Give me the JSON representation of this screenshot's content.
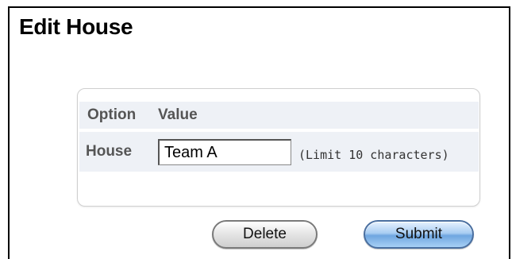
{
  "page": {
    "title": "Edit House"
  },
  "table": {
    "header_option": "Option",
    "header_value": "Value",
    "row_label": "House",
    "input_value": "Team A",
    "hint": "(Limit 10 characters)"
  },
  "buttons": {
    "delete_label": "Delete",
    "submit_label": "Submit"
  },
  "colors": {
    "header_row_bg": "#eef1f6",
    "submit_blue": "#6fa6e0",
    "label_gray": "#555555"
  }
}
